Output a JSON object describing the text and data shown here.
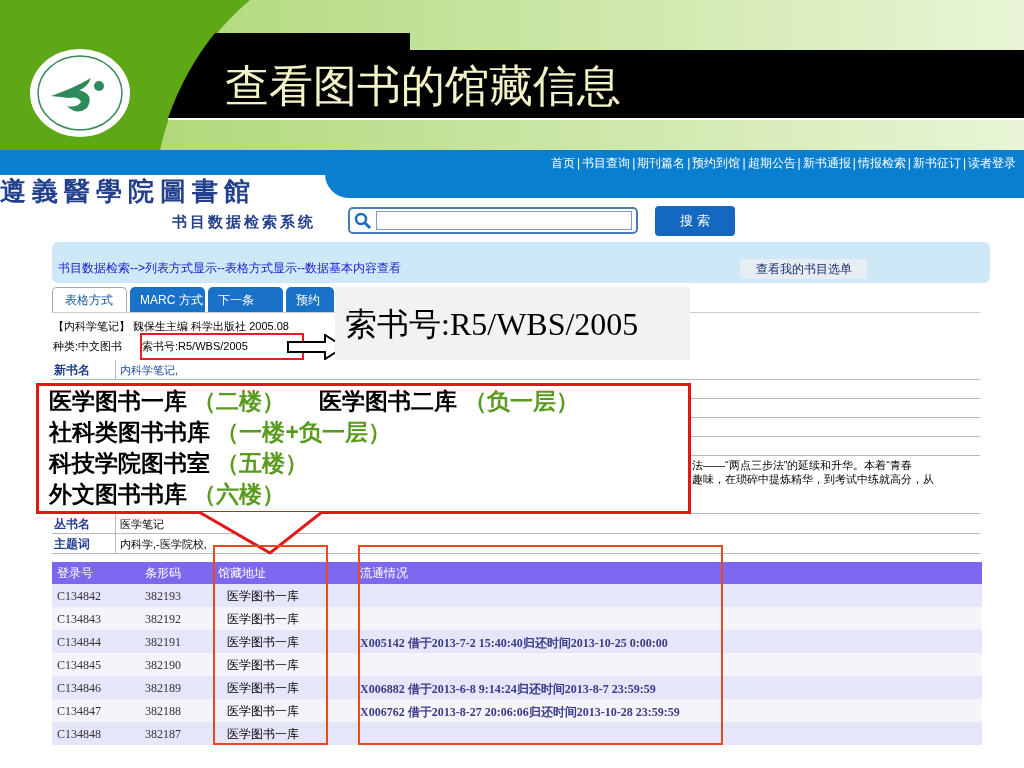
{
  "slide": {
    "title": "查看图书的馆藏信息"
  },
  "site": {
    "nav": [
      "首页",
      "书目查询",
      "期刊篇名",
      "预约到馆",
      "超期公告",
      "新书通报",
      "情报检索",
      "新书征订",
      "读者登录"
    ],
    "separator": "|",
    "library_name": "遵義醫學院圖書館",
    "system_name": "书目数据检索系统",
    "search_button": "搜 索"
  },
  "breadcrumb": {
    "text": "书目数据检索-->列表方式显示--表格方式显示--数据基本内容查看",
    "button": "查看我的书目选单"
  },
  "tabs": [
    {
      "label": "表格方式",
      "selected": true
    },
    {
      "label": "MARC 方式",
      "selected": false
    },
    {
      "label": "下一条",
      "selected": false
    },
    {
      "label": "预约",
      "selected": false
    }
  ],
  "book": {
    "summary": "【内科学笔记】 魏保生主编 科学出版社 2005.08",
    "category": "种类:中文图书",
    "call_number": "索书号:R5/WBS/2005"
  },
  "zoomed_call_number": "索书号:R5/WBS/2005",
  "details": [
    {
      "kind": "field",
      "label": "新书名",
      "value": "内科学笔记,"
    },
    {
      "kind": "blank"
    },
    {
      "kind": "blank"
    },
    {
      "kind": "blank"
    },
    {
      "kind": "blank"
    },
    {
      "kind": "text",
      "lines": [
        "法——“两点三步法”的延续和升华。本着“青春",
        "趣味，在琐碎中提炼精华，到考试中练就高分，从"
      ]
    },
    {
      "kind": "field",
      "label": "丛书名",
      "value": "医学笔记"
    },
    {
      "kind": "field",
      "label": "主题词",
      "value": "内科学,-医学院校,"
    }
  ],
  "location_note": {
    "lines": [
      [
        {
          "library": "医学图书一库",
          "floor": "（二楼）"
        },
        {
          "library": "医学图书二库",
          "floor": "（负一层）"
        }
      ],
      [
        {
          "library": "社科类图书书库",
          "floor": "（一楼+负一层）"
        }
      ],
      [
        {
          "library": "科技学院图书室",
          "floor": "（五楼）"
        }
      ],
      [
        {
          "library": "外文图书书库",
          "floor": "（六楼）"
        }
      ]
    ]
  },
  "holdings": {
    "columns": [
      "登录号",
      "条形码",
      "馆藏地址",
      "流通情况"
    ],
    "rows": [
      {
        "register": "C134842",
        "barcode": "382193",
        "location": "医学图书一库"
      },
      {
        "register": "C134843",
        "barcode": "382192",
        "location": "医学图书一库"
      },
      {
        "register": "C134844",
        "barcode": "382191",
        "location": "医学图书一库",
        "circulation": "X005142 借于2013-7-2 15:40:40归还时间2013-10-25 0:00:00"
      },
      {
        "register": "C134845",
        "barcode": "382190",
        "location": "医学图书一库"
      },
      {
        "register": "C134846",
        "barcode": "382189",
        "location": "医学图书一库",
        "circulation": "X006882 借于2013-6-8 9:14:24归还时间2013-8-7 23:59:59"
      },
      {
        "register": "C134847",
        "barcode": "382188",
        "location": "医学图书一库",
        "circulation": "X006762 借于2013-8-27 20:06:06归还时间2013-10-28 23:59:59"
      },
      {
        "register": "C134848",
        "barcode": "382187",
        "location": "医学图书一库"
      }
    ]
  }
}
